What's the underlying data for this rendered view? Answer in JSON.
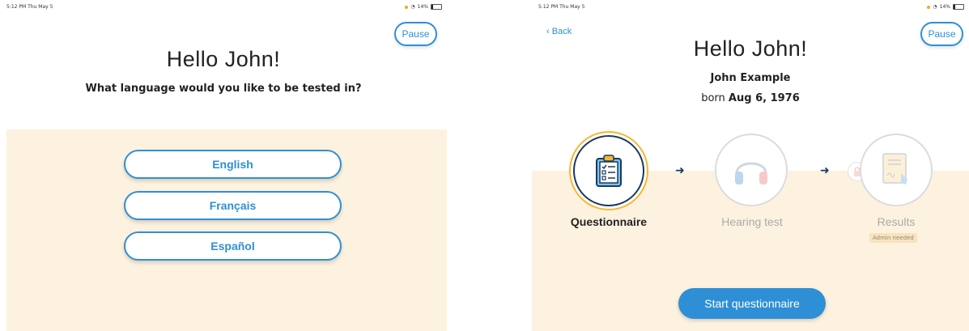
{
  "left": {
    "status": {
      "time": "5:12 PM  Thu May 5",
      "battery": "14%"
    },
    "pause_label": "Pause",
    "greeting": "Hello John!",
    "question": "What language would you like to be tested in?",
    "languages": [
      "English",
      "Français",
      "Español"
    ]
  },
  "right": {
    "status": {
      "time": "5:12 PM  Thu May 5",
      "battery": "14%"
    },
    "back_label": "Back",
    "pause_label": "Pause",
    "greeting": "Hello John!",
    "patient_name": "John Example",
    "born_prefix": "born",
    "born_date": "Aug 6, 1976",
    "steps": [
      {
        "label": "Questionnaire",
        "icon": "clipboard-icon",
        "state": "active"
      },
      {
        "label": "Hearing test",
        "icon": "headphones-icon",
        "state": "inactive"
      },
      {
        "label": "Results",
        "icon": "signed-document-icon",
        "state": "inactive",
        "badge": "Admin needed",
        "lock_icon": "lock-icon"
      }
    ],
    "start_label": "Start questionnaire"
  },
  "colors": {
    "accent": "#2f8fd6",
    "panel": "#fdf2df",
    "active_ring": "#f5b731",
    "navy": "#1b3a5c",
    "battery_dot": "#f6a623"
  }
}
